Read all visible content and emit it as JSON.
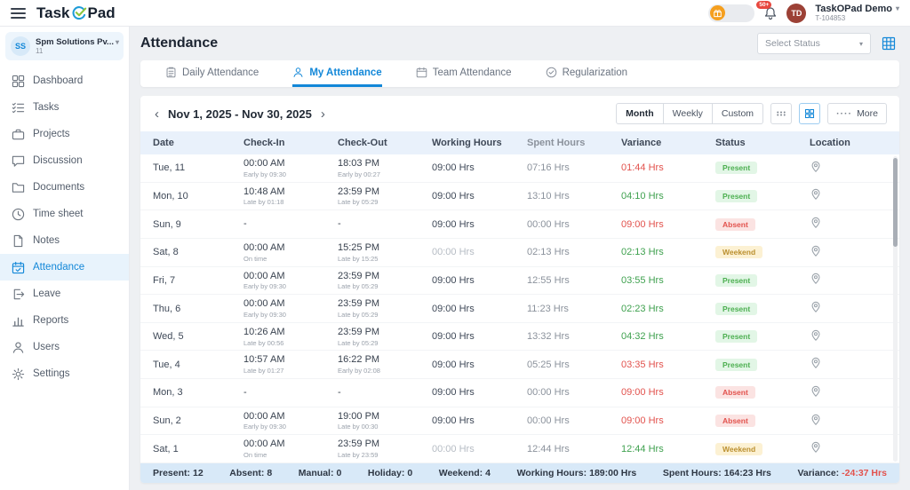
{
  "topbar": {
    "logo_prefix": "Task",
    "logo_suffix": "Pad",
    "notification_count": "50+",
    "avatar_initials": "TD",
    "account_name": "TaskOPad Demo",
    "account_id": "T-104853"
  },
  "sidebar": {
    "company_initials": "SS",
    "company_name": "Spm Solutions Pv...",
    "company_sub": "11",
    "items": [
      {
        "label": "Dashboard"
      },
      {
        "label": "Tasks"
      },
      {
        "label": "Projects"
      },
      {
        "label": "Discussion"
      },
      {
        "label": "Documents"
      },
      {
        "label": "Time sheet"
      },
      {
        "label": "Notes"
      },
      {
        "label": "Attendance",
        "active": true
      },
      {
        "label": "Leave"
      },
      {
        "label": "Reports"
      },
      {
        "label": "Users"
      },
      {
        "label": "Settings"
      }
    ]
  },
  "page": {
    "title": "Attendance",
    "status_filter": "Select Status"
  },
  "tabs": [
    {
      "label": "Daily Attendance"
    },
    {
      "label": "My Attendance",
      "active": true
    },
    {
      "label": "Team Attendance"
    },
    {
      "label": "Regularization"
    }
  ],
  "toolbar": {
    "date_range": "Nov 1, 2025 - Nov 30, 2025",
    "views": [
      "Month",
      "Weekly",
      "Custom"
    ],
    "more_label": "More"
  },
  "table": {
    "columns": [
      "Date",
      "Check-In",
      "Check-Out",
      "Working Hours",
      "Spent Hours",
      "Variance",
      "Status",
      "Location"
    ],
    "rows": [
      {
        "date": "Tue, 11",
        "checkin": "00:00 AM",
        "checkin_note": "Early by 09:30",
        "checkout": "18:03 PM",
        "checkout_note": "Early by 00:27",
        "working": "09:00 Hrs",
        "spent": "07:16 Hrs",
        "variance": "01:44 Hrs",
        "variance_color": "negative",
        "status": "Present"
      },
      {
        "date": "Mon, 10",
        "checkin": "10:48 AM",
        "checkin_note": "Late by 01:18",
        "checkout": "23:59 PM",
        "checkout_note": "Late by 05:29",
        "working": "09:00 Hrs",
        "spent": "13:10 Hrs",
        "variance": "04:10 Hrs",
        "variance_color": "positive",
        "status": "Present"
      },
      {
        "date": "Sun, 9",
        "checkin": "-",
        "checkin_note": "",
        "checkout": "-",
        "checkout_note": "",
        "working": "09:00 Hrs",
        "spent": "00:00 Hrs",
        "variance": "09:00 Hrs",
        "variance_color": "negative",
        "status": "Absent"
      },
      {
        "date": "Sat, 8",
        "checkin": "00:00 AM",
        "checkin_note": "On time",
        "checkout": "15:25 PM",
        "checkout_note": "Late by 15:25",
        "working": "00:00 Hrs",
        "working_muted": true,
        "spent": "02:13 Hrs",
        "variance": "02:13 Hrs",
        "variance_color": "positive",
        "status": "Weekend"
      },
      {
        "date": "Fri, 7",
        "checkin": "00:00 AM",
        "checkin_note": "Early by 09:30",
        "checkout": "23:59 PM",
        "checkout_note": "Late by 05:29",
        "working": "09:00 Hrs",
        "spent": "12:55 Hrs",
        "variance": "03:55 Hrs",
        "variance_color": "positive",
        "status": "Present"
      },
      {
        "date": "Thu, 6",
        "checkin": "00:00 AM",
        "checkin_note": "Early by 09:30",
        "checkout": "23:59 PM",
        "checkout_note": "Late by 05:29",
        "working": "09:00 Hrs",
        "spent": "11:23 Hrs",
        "variance": "02:23 Hrs",
        "variance_color": "positive",
        "status": "Present"
      },
      {
        "date": "Wed, 5",
        "checkin": "10:26 AM",
        "checkin_note": "Late by 00:56",
        "checkout": "23:59 PM",
        "checkout_note": "Late by 05:29",
        "working": "09:00 Hrs",
        "spent": "13:32 Hrs",
        "variance": "04:32 Hrs",
        "variance_color": "positive",
        "status": "Present"
      },
      {
        "date": "Tue, 4",
        "checkin": "10:57 AM",
        "checkin_note": "Late by 01:27",
        "checkout": "16:22 PM",
        "checkout_note": "Early by 02:08",
        "working": "09:00 Hrs",
        "spent": "05:25 Hrs",
        "variance": "03:35 Hrs",
        "variance_color": "negative",
        "status": "Present"
      },
      {
        "date": "Mon, 3",
        "checkin": "-",
        "checkin_note": "",
        "checkout": "-",
        "checkout_note": "",
        "working": "09:00 Hrs",
        "spent": "00:00 Hrs",
        "variance": "09:00 Hrs",
        "variance_color": "negative",
        "status": "Absent"
      },
      {
        "date": "Sun, 2",
        "checkin": "00:00 AM",
        "checkin_note": "Early by 09:30",
        "checkout": "19:00 PM",
        "checkout_note": "Late by 00:30",
        "working": "09:00 Hrs",
        "spent": "00:00 Hrs",
        "variance": "09:00 Hrs",
        "variance_color": "negative",
        "status": "Absent"
      },
      {
        "date": "Sat, 1",
        "checkin": "00:00 AM",
        "checkin_note": "On time",
        "checkout": "23:59 PM",
        "checkout_note": "Late by 23:59",
        "working": "00:00 Hrs",
        "working_muted": true,
        "spent": "12:44 Hrs",
        "variance": "12:44 Hrs",
        "variance_color": "positive",
        "status": "Weekend"
      }
    ]
  },
  "summary": {
    "items": [
      {
        "label": "Present",
        "value": "12"
      },
      {
        "label": "Absent",
        "value": "8"
      },
      {
        "label": "Manual",
        "value": "0"
      },
      {
        "label": "Holiday",
        "value": "0"
      },
      {
        "label": "Weekend",
        "value": "4"
      },
      {
        "label": "Working Hours",
        "value": "189:00 Hrs"
      },
      {
        "label": "Spent Hours",
        "value": "164:23 Hrs"
      },
      {
        "label": "Variance",
        "value": "-24:37 Hrs",
        "color": "negative"
      }
    ]
  },
  "colors": {
    "primary": "#1287d8",
    "positive": "#3fa14f",
    "negative": "#e2524d",
    "weekend": "#bb9030"
  }
}
